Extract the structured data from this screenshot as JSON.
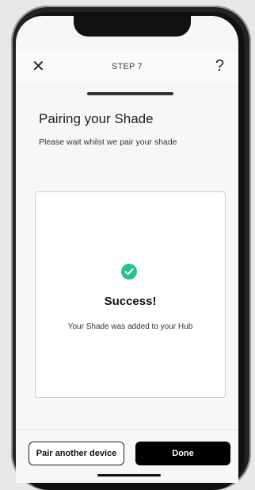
{
  "header": {
    "step_label": "STEP 7",
    "close_icon": "close-icon",
    "help_icon": "help-icon",
    "help_glyph": "?"
  },
  "content": {
    "title": "Pairing your Shade",
    "subtitle": "Please wait whilst we pair your shade"
  },
  "status_card": {
    "icon": "check-circle-icon",
    "heading": "Success!",
    "message": "Your Shade was added to your Hub"
  },
  "actions": {
    "secondary_label": "Pair another device",
    "primary_label": "Done"
  },
  "colors": {
    "success": "#27c38a",
    "primary_button": "#000000",
    "screen_background": "#f7f7f7"
  }
}
